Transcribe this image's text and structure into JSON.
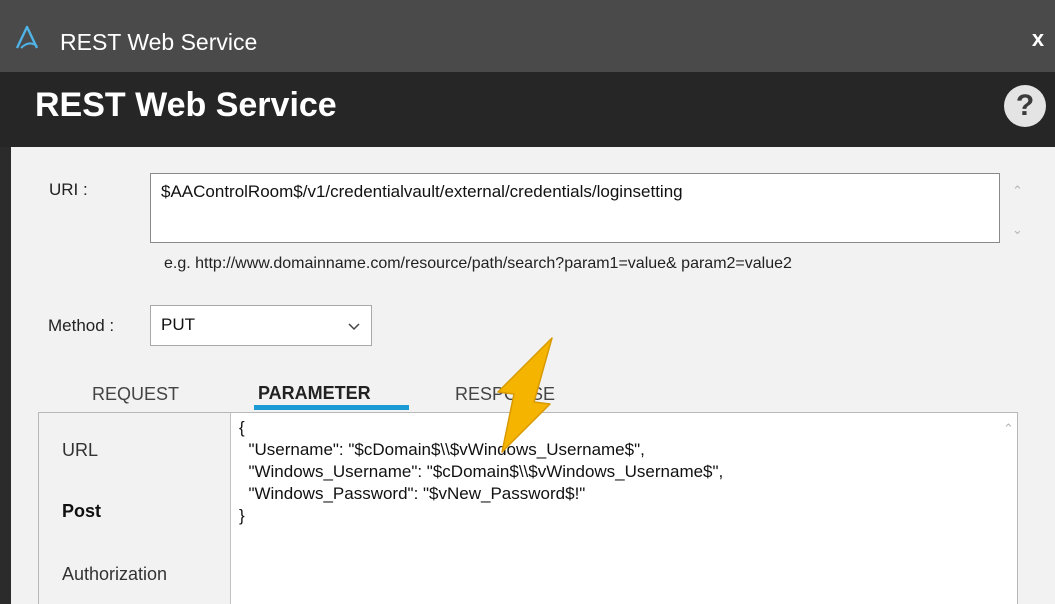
{
  "window": {
    "title": "REST Web Service",
    "close_label": "x"
  },
  "header": {
    "title": "REST Web Service",
    "help_label": "?"
  },
  "uri": {
    "label": "URI :",
    "value": "$AAControlRoom$/v1/credentialvault/external/credentials/loginsetting",
    "example": "e.g. http://www.domainname.com/resource/path/search?param1=value& param2=value2"
  },
  "method": {
    "label": "Method :",
    "value": "PUT"
  },
  "tabs": [
    {
      "label": "REQUEST"
    },
    {
      "label": "PARAMETER",
      "active": true
    },
    {
      "label": "RESPONSE"
    }
  ],
  "sidebar": {
    "items": [
      "URL",
      "Post",
      "Authorization"
    ]
  },
  "editor": {
    "lines": [
      "{",
      "  \"Username\": \"$cDomain$\\\\$vWindows_Username$\",",
      "  \"Windows_Username\": \"$cDomain$\\\\$vWindows_Username$\",",
      "  \"Windows_Password\": \"$vNew_Password$!\"",
      "}"
    ]
  },
  "colors": {
    "accent": "#1b9ad6",
    "arrow": "#f5b400",
    "titlebar": "#4a4a4a",
    "header": "#262626"
  }
}
